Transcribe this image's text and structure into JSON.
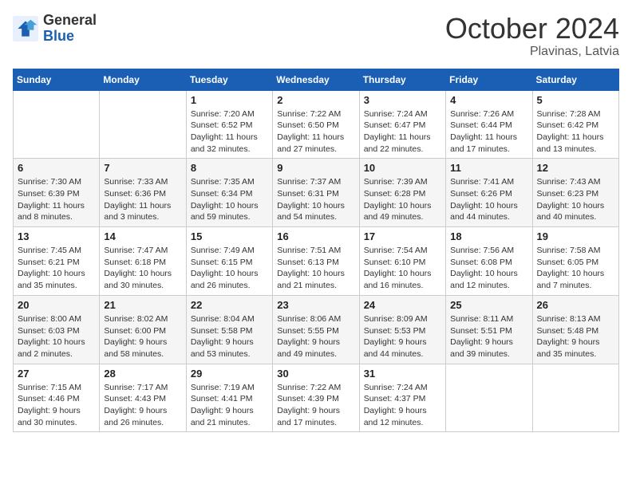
{
  "logo": {
    "general": "General",
    "blue": "Blue"
  },
  "title": {
    "month_year": "October 2024",
    "location": "Plavinas, Latvia"
  },
  "weekdays": [
    "Sunday",
    "Monday",
    "Tuesday",
    "Wednesday",
    "Thursday",
    "Friday",
    "Saturday"
  ],
  "weeks": [
    [
      {
        "day": "",
        "detail": ""
      },
      {
        "day": "",
        "detail": ""
      },
      {
        "day": "1",
        "detail": "Sunrise: 7:20 AM\nSunset: 6:52 PM\nDaylight: 11 hours\nand 32 minutes."
      },
      {
        "day": "2",
        "detail": "Sunrise: 7:22 AM\nSunset: 6:50 PM\nDaylight: 11 hours\nand 27 minutes."
      },
      {
        "day": "3",
        "detail": "Sunrise: 7:24 AM\nSunset: 6:47 PM\nDaylight: 11 hours\nand 22 minutes."
      },
      {
        "day": "4",
        "detail": "Sunrise: 7:26 AM\nSunset: 6:44 PM\nDaylight: 11 hours\nand 17 minutes."
      },
      {
        "day": "5",
        "detail": "Sunrise: 7:28 AM\nSunset: 6:42 PM\nDaylight: 11 hours\nand 13 minutes."
      }
    ],
    [
      {
        "day": "6",
        "detail": "Sunrise: 7:30 AM\nSunset: 6:39 PM\nDaylight: 11 hours\nand 8 minutes."
      },
      {
        "day": "7",
        "detail": "Sunrise: 7:33 AM\nSunset: 6:36 PM\nDaylight: 11 hours\nand 3 minutes."
      },
      {
        "day": "8",
        "detail": "Sunrise: 7:35 AM\nSunset: 6:34 PM\nDaylight: 10 hours\nand 59 minutes."
      },
      {
        "day": "9",
        "detail": "Sunrise: 7:37 AM\nSunset: 6:31 PM\nDaylight: 10 hours\nand 54 minutes."
      },
      {
        "day": "10",
        "detail": "Sunrise: 7:39 AM\nSunset: 6:28 PM\nDaylight: 10 hours\nand 49 minutes."
      },
      {
        "day": "11",
        "detail": "Sunrise: 7:41 AM\nSunset: 6:26 PM\nDaylight: 10 hours\nand 44 minutes."
      },
      {
        "day": "12",
        "detail": "Sunrise: 7:43 AM\nSunset: 6:23 PM\nDaylight: 10 hours\nand 40 minutes."
      }
    ],
    [
      {
        "day": "13",
        "detail": "Sunrise: 7:45 AM\nSunset: 6:21 PM\nDaylight: 10 hours\nand 35 minutes."
      },
      {
        "day": "14",
        "detail": "Sunrise: 7:47 AM\nSunset: 6:18 PM\nDaylight: 10 hours\nand 30 minutes."
      },
      {
        "day": "15",
        "detail": "Sunrise: 7:49 AM\nSunset: 6:15 PM\nDaylight: 10 hours\nand 26 minutes."
      },
      {
        "day": "16",
        "detail": "Sunrise: 7:51 AM\nSunset: 6:13 PM\nDaylight: 10 hours\nand 21 minutes."
      },
      {
        "day": "17",
        "detail": "Sunrise: 7:54 AM\nSunset: 6:10 PM\nDaylight: 10 hours\nand 16 minutes."
      },
      {
        "day": "18",
        "detail": "Sunrise: 7:56 AM\nSunset: 6:08 PM\nDaylight: 10 hours\nand 12 minutes."
      },
      {
        "day": "19",
        "detail": "Sunrise: 7:58 AM\nSunset: 6:05 PM\nDaylight: 10 hours\nand 7 minutes."
      }
    ],
    [
      {
        "day": "20",
        "detail": "Sunrise: 8:00 AM\nSunset: 6:03 PM\nDaylight: 10 hours\nand 2 minutes."
      },
      {
        "day": "21",
        "detail": "Sunrise: 8:02 AM\nSunset: 6:00 PM\nDaylight: 9 hours\nand 58 minutes."
      },
      {
        "day": "22",
        "detail": "Sunrise: 8:04 AM\nSunset: 5:58 PM\nDaylight: 9 hours\nand 53 minutes."
      },
      {
        "day": "23",
        "detail": "Sunrise: 8:06 AM\nSunset: 5:55 PM\nDaylight: 9 hours\nand 49 minutes."
      },
      {
        "day": "24",
        "detail": "Sunrise: 8:09 AM\nSunset: 5:53 PM\nDaylight: 9 hours\nand 44 minutes."
      },
      {
        "day": "25",
        "detail": "Sunrise: 8:11 AM\nSunset: 5:51 PM\nDaylight: 9 hours\nand 39 minutes."
      },
      {
        "day": "26",
        "detail": "Sunrise: 8:13 AM\nSunset: 5:48 PM\nDaylight: 9 hours\nand 35 minutes."
      }
    ],
    [
      {
        "day": "27",
        "detail": "Sunrise: 7:15 AM\nSunset: 4:46 PM\nDaylight: 9 hours\nand 30 minutes."
      },
      {
        "day": "28",
        "detail": "Sunrise: 7:17 AM\nSunset: 4:43 PM\nDaylight: 9 hours\nand 26 minutes."
      },
      {
        "day": "29",
        "detail": "Sunrise: 7:19 AM\nSunset: 4:41 PM\nDaylight: 9 hours\nand 21 minutes."
      },
      {
        "day": "30",
        "detail": "Sunrise: 7:22 AM\nSunset: 4:39 PM\nDaylight: 9 hours\nand 17 minutes."
      },
      {
        "day": "31",
        "detail": "Sunrise: 7:24 AM\nSunset: 4:37 PM\nDaylight: 9 hours\nand 12 minutes."
      },
      {
        "day": "",
        "detail": ""
      },
      {
        "day": "",
        "detail": ""
      }
    ]
  ]
}
